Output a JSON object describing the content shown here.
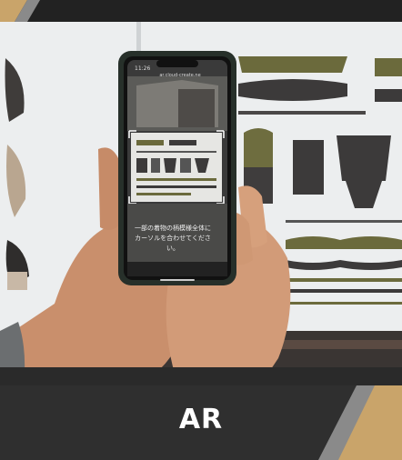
{
  "caption": {
    "title": "AR"
  },
  "phone": {
    "time": "11:26",
    "url": "ar.cloud-create.ne",
    "instruction_line1": "一部の着物の柄模様全体に",
    "instruction_line2": "カーソルを合わせてください。"
  },
  "colors": {
    "accent_gold": "#c9a46a",
    "accent_gray": "#8a8a8a",
    "panel_dark": "#2f2f2f",
    "caption_text": "#ffffff"
  }
}
